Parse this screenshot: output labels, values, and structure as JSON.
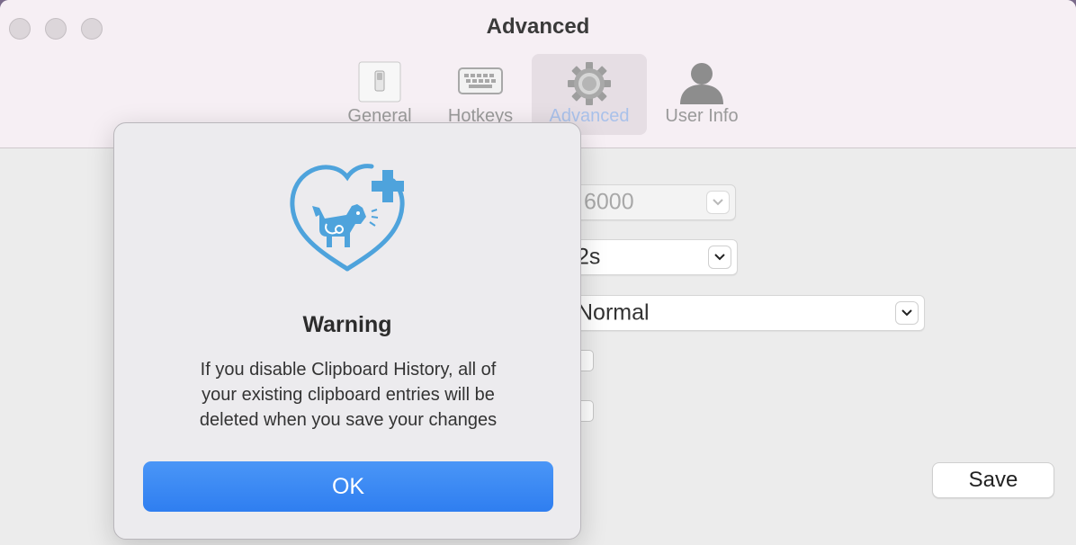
{
  "window": {
    "title": "Advanced",
    "toolbar_tabs": [
      {
        "label": "General",
        "icon": "switch-icon",
        "active": false
      },
      {
        "label": "Hotkeys",
        "icon": "keyboard-icon",
        "active": false
      },
      {
        "label": "Advanced",
        "icon": "gear-icon",
        "active": true
      },
      {
        "label": "User Info",
        "icon": "person-icon",
        "active": false
      }
    ]
  },
  "settings": {
    "popup_1_value": "6000",
    "popup_2_value": "2s",
    "popup_3_value": "Normal",
    "save_label": "Save"
  },
  "alert": {
    "logo_icon": "pet-heart-plus-logo",
    "title": "Warning",
    "message_lines": [
      "If you disable Clipboard History, all of",
      "your existing clipboard entries will be",
      "deleted when you save your changes"
    ],
    "ok_label": "OK"
  },
  "colors": {
    "accent_blue": "#3683f2",
    "logo_blue": "#4ea3dc"
  }
}
